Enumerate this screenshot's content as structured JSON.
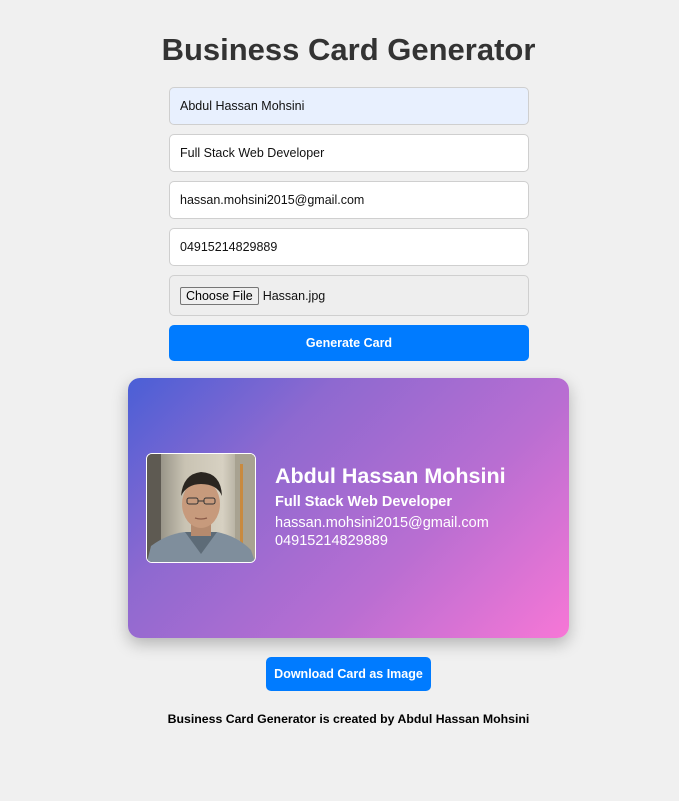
{
  "page": {
    "title": "Business Card Generator"
  },
  "form": {
    "name_value": "Abdul Hassan Mohsini",
    "job_value": "Full Stack Web Developer",
    "email_value": "hassan.mohsini2015@gmail.com",
    "phone_value": "04915214829889",
    "file_button_label": "Choose File",
    "file_name": "Hassan.jpg",
    "generate_label": "Generate Card"
  },
  "card": {
    "name": "Abdul Hassan Mohsini",
    "title": "Full Stack Web Developer",
    "email": "hassan.mohsini2015@gmail.com",
    "phone": "04915214829889",
    "gradient_start": "#4a5fd6",
    "gradient_end": "#f777d6"
  },
  "actions": {
    "download_label": "Download Card as Image"
  },
  "footer": {
    "text": "Business Card Generator is created by Abdul Hassan Mohsini"
  },
  "colors": {
    "accent": "#007bff",
    "background": "#f0f0f0",
    "autofill": "#e8f0fe"
  },
  "icons": {
    "profile_photo": "person-portrait"
  }
}
